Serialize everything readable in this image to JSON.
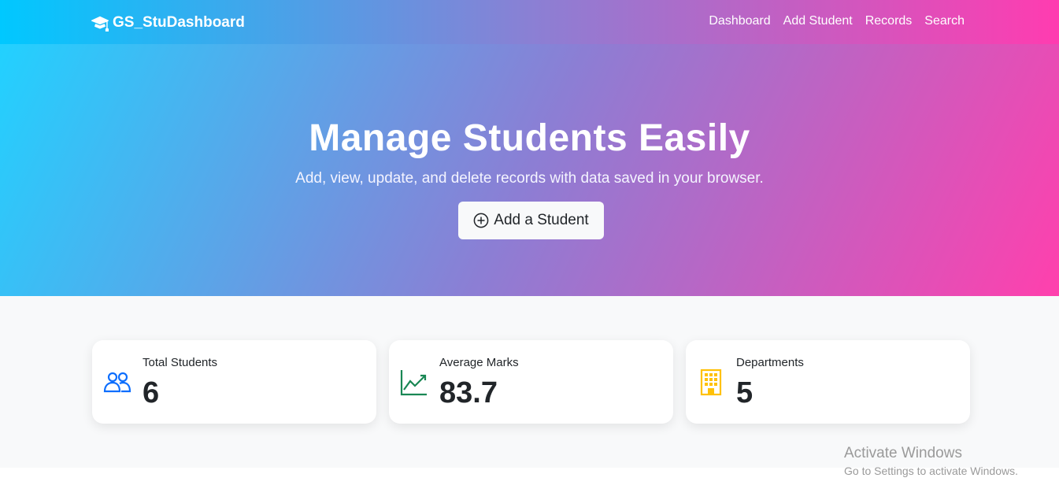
{
  "navbar": {
    "brand": "GS_StuDashboard",
    "brand_icon": "graduation-cap-icon",
    "links": [
      "Dashboard",
      "Add Student",
      "Records",
      "Search"
    ]
  },
  "hero": {
    "title": "Manage Students Easily",
    "subtitle": "Add, view, update, and delete records with data saved in your browser.",
    "button_label": "Add a Student",
    "button_icon": "plus-circle-icon"
  },
  "stats": [
    {
      "label": "Total Students",
      "value": "6",
      "icon": "people-icon",
      "color": "#0d6efd"
    },
    {
      "label": "Average Marks",
      "value": "83.7",
      "icon": "graph-up-icon",
      "color": "#198754"
    },
    {
      "label": "Departments",
      "value": "5",
      "icon": "building-icon",
      "color": "#ffc107"
    }
  ],
  "watermark": {
    "title": "Activate Windows",
    "subtitle": "Go to Settings to activate Windows."
  },
  "colors": {
    "gradient_start": "#00c8ff",
    "gradient_mid": "#8a80d4",
    "gradient_end": "#ff3cb0",
    "stats_background": "#f8f9fa"
  }
}
